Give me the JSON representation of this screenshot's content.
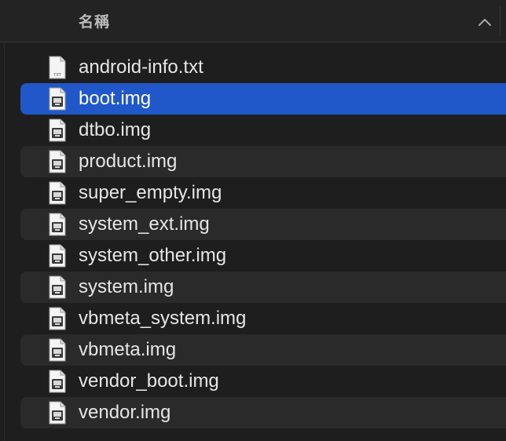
{
  "header": {
    "name_column_label": "名稱",
    "sort_indicator_icon": "chevron-up-icon"
  },
  "colors": {
    "background": "#1e1e1e",
    "alternate_row": "#2a2a2a",
    "selection": "#2158c9",
    "text": "#e6e6e6"
  },
  "files": [
    {
      "name": "android-info.txt",
      "icon": "txt-file-icon",
      "selected": false
    },
    {
      "name": "boot.img",
      "icon": "disk-image-file-icon",
      "selected": true
    },
    {
      "name": "dtbo.img",
      "icon": "disk-image-file-icon",
      "selected": false
    },
    {
      "name": "product.img",
      "icon": "disk-image-file-icon",
      "selected": false
    },
    {
      "name": "super_empty.img",
      "icon": "disk-image-file-icon",
      "selected": false
    },
    {
      "name": "system_ext.img",
      "icon": "disk-image-file-icon",
      "selected": false
    },
    {
      "name": "system_other.img",
      "icon": "disk-image-file-icon",
      "selected": false
    },
    {
      "name": "system.img",
      "icon": "disk-image-file-icon",
      "selected": false
    },
    {
      "name": "vbmeta_system.img",
      "icon": "disk-image-file-icon",
      "selected": false
    },
    {
      "name": "vbmeta.img",
      "icon": "disk-image-file-icon",
      "selected": false
    },
    {
      "name": "vendor_boot.img",
      "icon": "disk-image-file-icon",
      "selected": false
    },
    {
      "name": "vendor.img",
      "icon": "disk-image-file-icon",
      "selected": false
    }
  ]
}
